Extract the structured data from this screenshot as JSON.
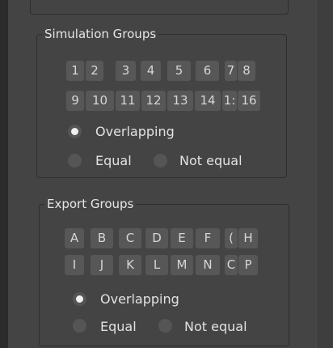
{
  "simulation_groups": {
    "title": "Simulation Groups",
    "row1": [
      "1",
      "2",
      "3",
      "4",
      "5",
      "6",
      "7",
      "8"
    ],
    "row2": [
      "9",
      "10",
      "11",
      "12",
      "13",
      "14",
      "1:",
      "16"
    ],
    "overlapping_label": "Overlapping",
    "equal_label": "Equal",
    "not_equal_label": "Not equal",
    "selected": "Overlapping"
  },
  "export_groups": {
    "title": "Export Groups",
    "row1": [
      "A",
      "B",
      "C",
      "D",
      "E",
      "F",
      "(",
      "H"
    ],
    "row2": [
      "I",
      "J",
      "K",
      "L",
      "M",
      "N",
      "C",
      "P"
    ],
    "overlapping_label": "Overlapping",
    "equal_label": "Equal",
    "not_equal_label": "Not equal",
    "selected": "Overlapping"
  }
}
